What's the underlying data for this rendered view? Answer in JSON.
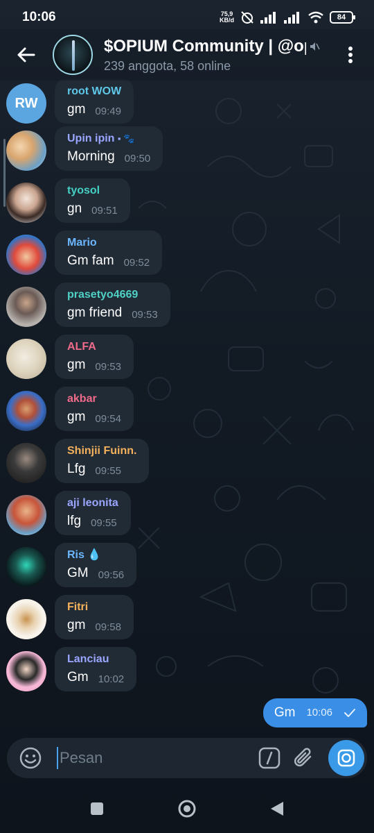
{
  "status_bar": {
    "time": "10:06",
    "net_speed_value": "75,9",
    "net_speed_unit": "KB/d",
    "battery": "84"
  },
  "header": {
    "title": "$OPIUM Community | @op",
    "subtitle": "239 anggota, 58 online"
  },
  "messages": [
    {
      "sender": "root WOW",
      "text": "gm",
      "time": "09:49",
      "color": "#5fc7e8",
      "avatar": "RW"
    },
    {
      "sender": "Upin ipin",
      "text": "Morning",
      "time": "09:50",
      "color": "#9aa6ff",
      "avatar": ""
    },
    {
      "sender": "tyosol",
      "text": "gn",
      "time": "09:51",
      "color": "#45d0c4",
      "avatar": ""
    },
    {
      "sender": "Mario",
      "text": "Gm fam",
      "time": "09:52",
      "color": "#6cb6ff",
      "avatar": ""
    },
    {
      "sender": "prasetyo4669",
      "text": "gm friend",
      "time": "09:53",
      "color": "#4fd1c5",
      "avatar": ""
    },
    {
      "sender": "ALFA",
      "text": "gm",
      "time": "09:53",
      "color": "#f06a8a",
      "avatar": ""
    },
    {
      "sender": "akbar",
      "text": "gm",
      "time": "09:54",
      "color": "#f06a8a",
      "avatar": ""
    },
    {
      "sender": "Shinjii Fuinn.",
      "text": "Lfg",
      "time": "09:55",
      "color": "#f5b15b",
      "avatar": ""
    },
    {
      "sender": "aji leonita",
      "text": "lfg",
      "time": "09:55",
      "color": "#9aa6ff",
      "avatar": ""
    },
    {
      "sender": "Ris",
      "text": "GM",
      "time": "09:56",
      "color": "#6cb6ff",
      "avatar": ""
    },
    {
      "sender": "Fitri",
      "text": "gm",
      "time": "09:58",
      "color": "#f5b15b",
      "avatar": ""
    },
    {
      "sender": "Lanciau",
      "text": "Gm",
      "time": "10:02",
      "color": "#9aa6ff",
      "avatar": ""
    }
  ],
  "outgoing": {
    "text": "Gm",
    "time": "10:06"
  },
  "input": {
    "placeholder": "Pesan"
  },
  "colors": {
    "accent": "#3a8ee6",
    "bubble": "#212b36"
  }
}
